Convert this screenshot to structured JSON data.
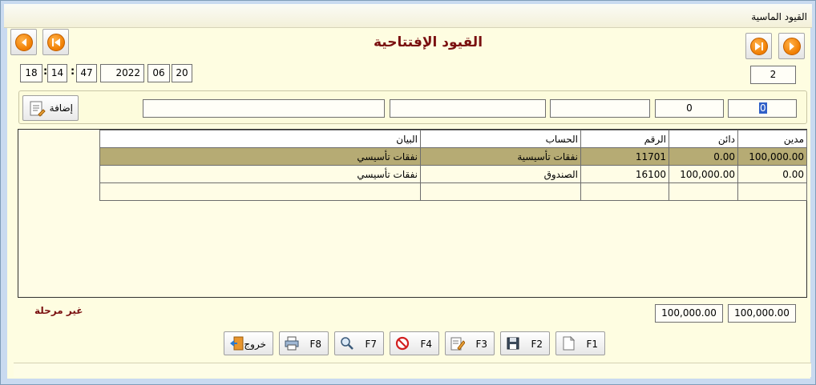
{
  "window": {
    "title": "القيود الماسية"
  },
  "header": {
    "title": "القيود الإفتتاحية"
  },
  "time": {
    "hour": "18",
    "minute": "14",
    "second": "47",
    "sep": ":"
  },
  "date": {
    "year": "2022",
    "month": "06",
    "day": "20"
  },
  "record_number": "2",
  "entry_row": {
    "add_label": "إضافة",
    "debit": "0",
    "credit": "0",
    "number": "",
    "account": "",
    "description": ""
  },
  "grid": {
    "columns": [
      "مدين",
      "دائن",
      "الرقم",
      "الحساب",
      "البيان"
    ],
    "rows": [
      {
        "debit": "100,000.00",
        "credit": "0.00",
        "number": "11701",
        "account": "نفقات تأسيسية",
        "description": "نفقات تأسيسي"
      },
      {
        "debit": "0.00",
        "credit": "100,000.00",
        "number": "16100",
        "account": "الصندوق",
        "description": "نفقات تأسيسي"
      },
      {
        "debit": "",
        "credit": "",
        "number": "",
        "account": "",
        "description": ""
      }
    ]
  },
  "totals": {
    "debit": "100,000.00",
    "credit": "100,000.00"
  },
  "status": "غير مرحلة",
  "buttons": {
    "f1": "F1",
    "f2": "F2",
    "f3": "F3",
    "f4": "F4",
    "f7": "F7",
    "f8": "F8",
    "exit": "خروج"
  },
  "icons": {
    "nav_first": "skip-first-icon",
    "nav_prev": "prev-icon",
    "nav_next": "next-icon",
    "nav_last": "skip-last-icon",
    "new": "new-document-icon",
    "save": "floppy-icon",
    "edit": "edit-pencil-icon",
    "delete": "no-entry-icon",
    "search": "magnifier-icon",
    "print": "printer-icon",
    "exit": "exit-door-icon"
  },
  "colors": {
    "accent_orange": "#f07d00",
    "heading": "#7a1010",
    "selected_row": "#b6ab74",
    "background": "#fefde1"
  }
}
